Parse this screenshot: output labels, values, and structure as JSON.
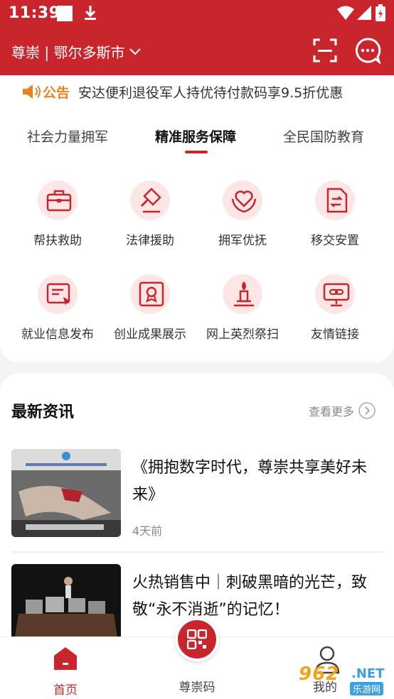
{
  "status_bar": {
    "time": "11:39"
  },
  "header": {
    "city_label": "尊崇 | 鄂尔多斯市"
  },
  "notice": {
    "tag": "公告",
    "text": "安达便利退役军人持优待付款码享9.5折优惠"
  },
  "tabs": [
    {
      "label": "社会力量拥军"
    },
    {
      "label": "精准服务保障"
    },
    {
      "label": "全民国防教育"
    }
  ],
  "grid": [
    {
      "label": "帮扶救助",
      "icon": "briefcase-icon"
    },
    {
      "label": "法律援助",
      "icon": "gavel-icon"
    },
    {
      "label": "拥军优抚",
      "icon": "heart-hands-icon"
    },
    {
      "label": "移交安置",
      "icon": "transfer-doc-icon"
    },
    {
      "label": "就业信息发布",
      "icon": "job-board-icon"
    },
    {
      "label": "创业成果展示",
      "icon": "certificate-icon"
    },
    {
      "label": "网上英烈祭扫",
      "icon": "candle-icon"
    },
    {
      "label": "友情链接",
      "icon": "link-monitor-icon"
    }
  ],
  "news": {
    "title": "最新资讯",
    "more": "查看更多",
    "items": [
      {
        "title": "《拥抱数字时代，尊崇共享美好未来》",
        "time": "4天前"
      },
      {
        "title": "火热销售中｜刺破黑暗的光芒，致敬“永不消逝”的记忆！",
        "time": ""
      }
    ]
  },
  "bottom_nav": {
    "home": "首页",
    "code": "尊崇码",
    "me": "我的"
  },
  "watermark": {
    "num": "962",
    "net": ".NET",
    "sub": "乐游网"
  },
  "colors": {
    "primary": "#c8262c",
    "notice_tag": "#e9831f",
    "icon_bg": "#fce7e6"
  }
}
